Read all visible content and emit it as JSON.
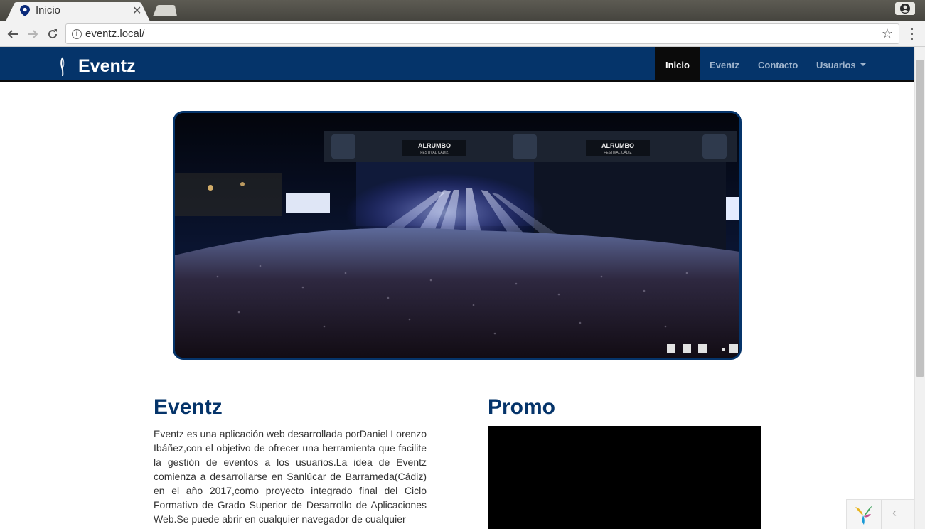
{
  "browser": {
    "tab_title": "Inicio",
    "tab_close": "✕",
    "url": "eventz.local/"
  },
  "navbar": {
    "brand": "Eventz",
    "items": [
      {
        "label": "Inicio",
        "active": true
      },
      {
        "label": "Eventz",
        "active": false
      },
      {
        "label": "Contacto",
        "active": false
      },
      {
        "label": "Usuarios",
        "active": false,
        "dropdown": true
      }
    ]
  },
  "carousel": {
    "image_alt": "ALRUMBO FESTIVAL CÁDIZ",
    "stage_banner": "ALRUMBO",
    "stage_banner_sub": "FESTIVAL CÁDIZ",
    "indicator_count": 5,
    "active_indicator": 3
  },
  "about": {
    "heading": "Eventz",
    "text": "Eventz es una aplicación web desarrollada porDaniel Lorenzo Ibáñez,con el objetivo de ofrecer una herramienta que facilite la gestión de eventos a los usuarios.La idea de Eventz comienza a desarrollarse en Sanlúcar de Barrameda(Cádiz) en el año 2017,como proyecto integrado final del Ciclo Formativo de Grado Superior de Desarrollo de Aplicaciones Web.Se puede abrir en cualquier navegador de cualquier"
  },
  "promo": {
    "heading": "Promo"
  },
  "colors": {
    "navbar_bg": "#05346a",
    "heading": "#05346a",
    "active_nav": "#0b0b0b"
  }
}
